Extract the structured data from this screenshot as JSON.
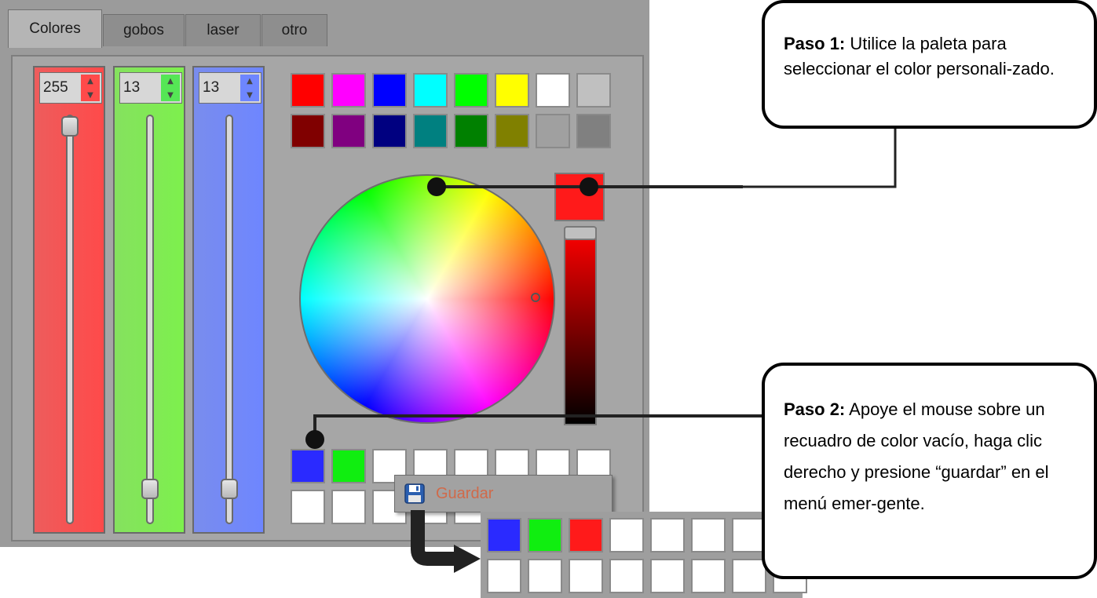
{
  "tabs": [
    "Colores",
    "gobos",
    "laser",
    "otro"
  ],
  "active_tab": "Colores",
  "sliders": [
    {
      "channel": "red",
      "value": "255",
      "level": 1.0,
      "color": "#ff4a4a"
    },
    {
      "channel": "green",
      "value": "13",
      "level": 0.05,
      "color": "#7df04d"
    },
    {
      "channel": "blue",
      "value": "13",
      "level": 0.05,
      "color": "#6e86ff"
    }
  ],
  "preset_colors": {
    "row1": [
      "#ff0000",
      "#ff00ff",
      "#0000ff",
      "#00ffff",
      "#00ff00",
      "#ffff00",
      "#ffffff",
      "#c0c0c0"
    ],
    "row2": [
      "#800000",
      "#800080",
      "#000080",
      "#008080",
      "#008000",
      "#808000",
      "#a0a0a0",
      "#808080"
    ]
  },
  "current_color": "#ff1a1a",
  "custom_colors_before": {
    "row1": [
      "#2a2aff",
      "#10ee10",
      "#ffffff",
      "#ffffff",
      "#ffffff",
      "#ffffff",
      "#ffffff",
      "#ffffff"
    ],
    "row2": [
      "#ffffff",
      "#ffffff",
      "#ffffff",
      "#ffffff",
      "#ffffff",
      "#ffffff",
      "#ffffff",
      "#ffffff"
    ]
  },
  "context_menu": {
    "icon": "floppy-disk-icon",
    "label": "Guardar"
  },
  "custom_colors_after": {
    "row1": [
      "#2a2aff",
      "#10ee10",
      "#ff1a1a",
      "#ffffff",
      "#ffffff",
      "#ffffff",
      "#ffffff",
      "#ffffff"
    ],
    "row2": [
      "#ffffff",
      "#ffffff",
      "#ffffff",
      "#ffffff",
      "#ffffff",
      "#ffffff",
      "#ffffff",
      "#ffffff"
    ]
  },
  "callouts": {
    "step1": {
      "title": "Paso 1:",
      "text": " Utilice la paleta para seleccionar el color personali-zado."
    },
    "step2": {
      "title": "Paso 2:",
      "text": " Apoye el mouse sobre un recuadro de color vacío, haga clic derecho y presione “guardar” en el menú emer-gente."
    }
  }
}
